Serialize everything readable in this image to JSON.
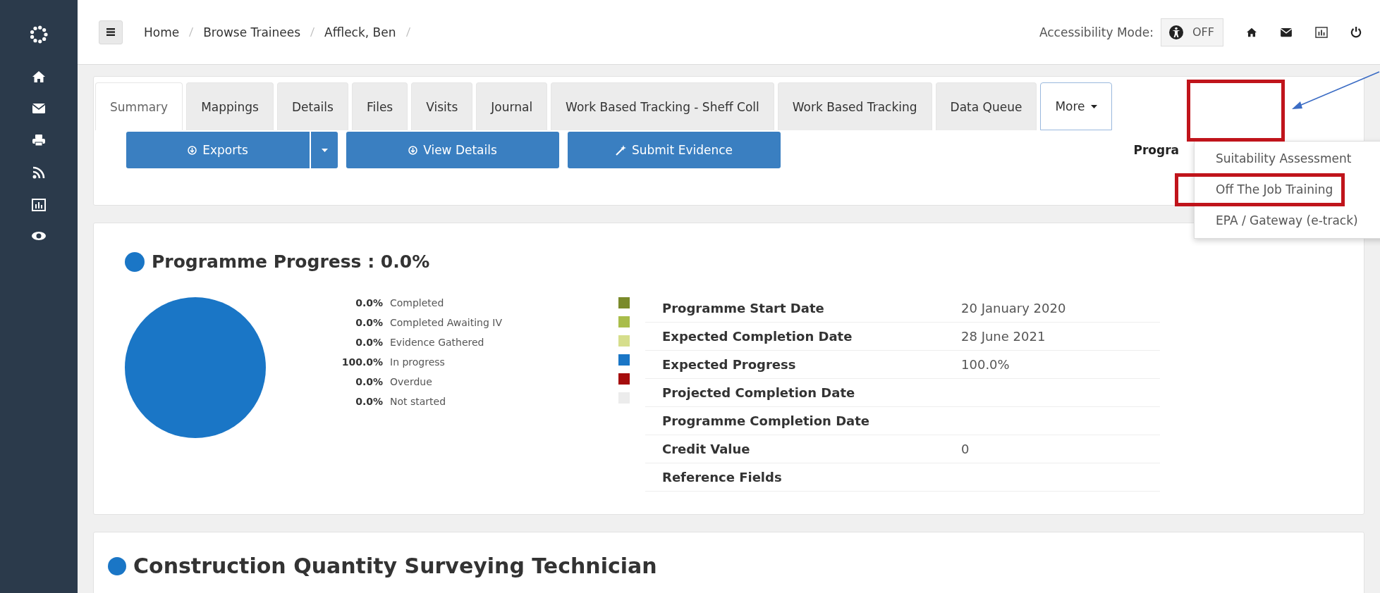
{
  "breadcrumb": [
    "Home",
    "Browse Trainees",
    "Affleck, Ben"
  ],
  "accessibility": {
    "label": "Accessibility Mode:",
    "state_text": "OFF",
    "on": false
  },
  "tabs": [
    {
      "label": "Summary",
      "selected": true
    },
    {
      "label": "Mappings",
      "selected": false
    },
    {
      "label": "Details",
      "selected": false
    },
    {
      "label": "Files",
      "selected": false
    },
    {
      "label": "Visits",
      "selected": false
    },
    {
      "label": "Journal",
      "selected": false
    },
    {
      "label": "Work Based Tracking - Sheff Coll",
      "selected": false
    },
    {
      "label": "Work Based Tracking",
      "selected": false
    },
    {
      "label": "Data Queue",
      "selected": false
    }
  ],
  "more_menu": {
    "label": "More",
    "expanded": true,
    "items": [
      {
        "label": "Suitability Assessment",
        "highlighted": false
      },
      {
        "label": "Off The Job Training",
        "highlighted": true
      },
      {
        "label": "EPA / Gateway (e-track)",
        "highlighted": false
      }
    ]
  },
  "actions": [
    {
      "label": "Exports",
      "kind": "split"
    },
    {
      "label": "View Details",
      "kind": "plain"
    },
    {
      "label": "Submit Evidence",
      "kind": "wand"
    }
  ],
  "partial_label": "Progra",
  "progress": {
    "title": "Programme Progress : 0.0%",
    "legend": [
      {
        "value": "0.0%",
        "color": "#7a8a2a"
      },
      {
        "value": "0.0%",
        "color": "#a9bd4a"
      },
      {
        "value": "0.0%",
        "color": "#d6de8c"
      },
      {
        "value": "100.0%",
        "color": "#1a76c6"
      },
      {
        "value": "0.0%",
        "color": "#a50d0d"
      },
      {
        "value": "0.0%",
        "color": "#ececec"
      }
    ],
    "chart_data": {
      "type": "pie",
      "categories": [
        "Completed",
        "Completed Awaiting IV",
        "Evidence Gathered",
        "In progress",
        "Overdue",
        "Not started"
      ],
      "values": [
        0,
        0,
        0,
        100,
        0,
        0
      ]
    },
    "details": [
      {
        "label": "Programme Start Date",
        "value": "20 January 2020"
      },
      {
        "label": "Expected Completion Date",
        "value": "28 June 2021"
      },
      {
        "label": "Expected Progress",
        "value": "100.0%"
      },
      {
        "label": "Projected Completion Date"
      },
      {
        "label": "Programme Completion Date"
      },
      {
        "label": "Credit Value",
        "value": "0"
      },
      {
        "label": "Reference Fields"
      }
    ]
  },
  "qualification": {
    "title": "Construction Quantity Surveying Technician"
  }
}
